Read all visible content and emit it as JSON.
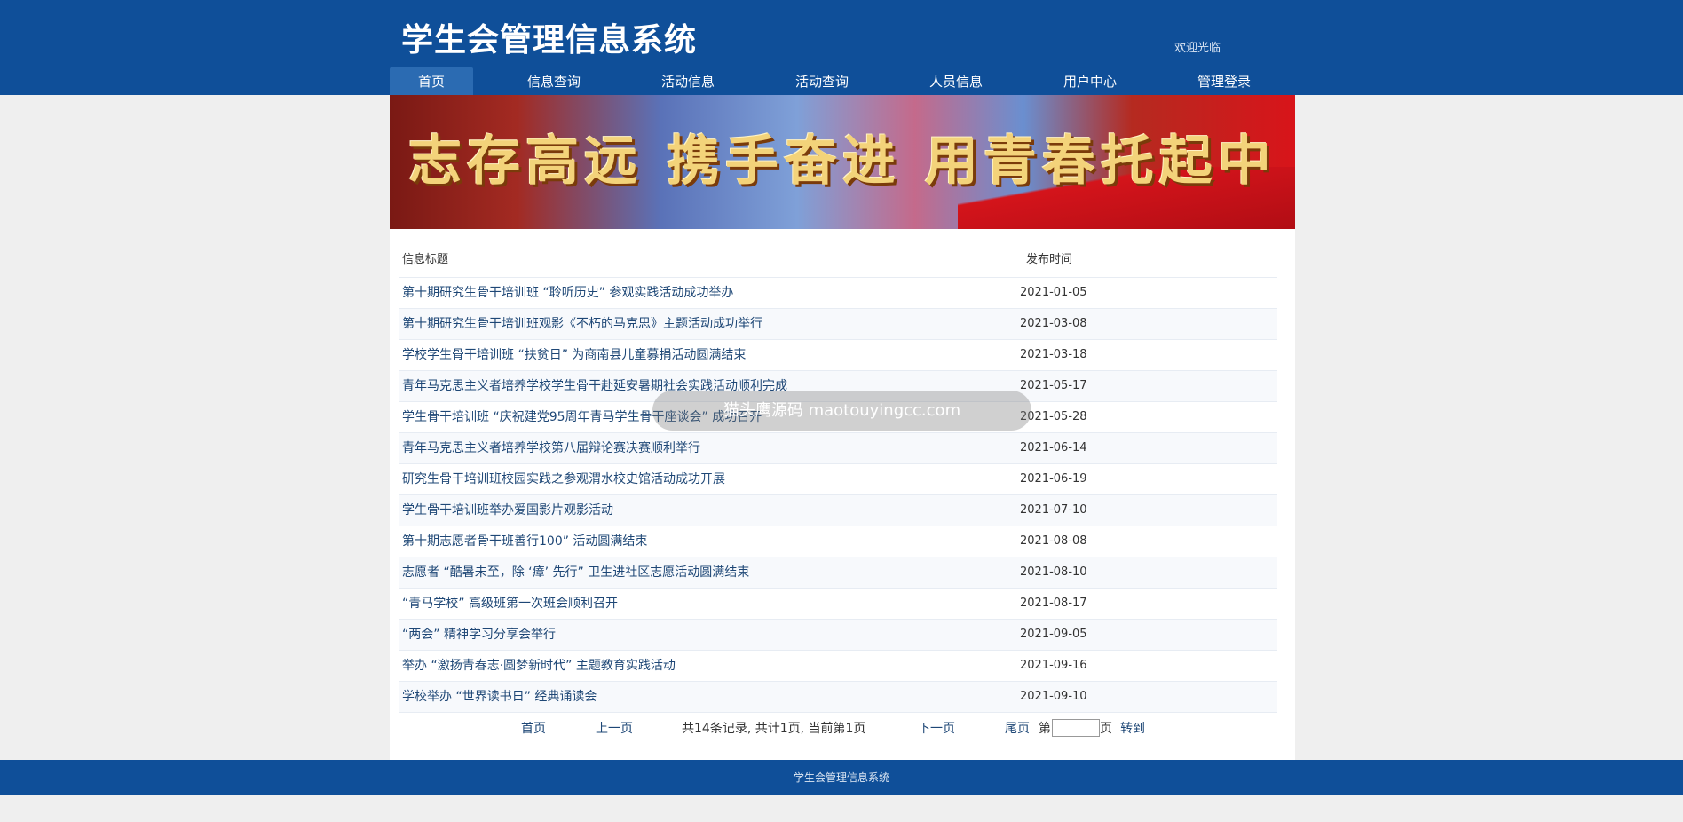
{
  "header": {
    "title": "学生会管理信息系统",
    "welcome": "欢迎光临"
  },
  "nav": {
    "items": [
      "首页",
      "信息查询",
      "活动信息",
      "活动查询",
      "人员信息",
      "用户中心",
      "管理登录"
    ]
  },
  "banner": {
    "slogan": "志存高远 携手奋进 用青春托起中国梦"
  },
  "table": {
    "headers": {
      "title": "信息标题",
      "date": "发布时间"
    },
    "rows": [
      {
        "title": "第十期研究生骨干培训班 “聆听历史” 参观实践活动成功举办",
        "date": "2021-01-05"
      },
      {
        "title": "第十期研究生骨干培训班观影《不朽的马克思》主题活动成功举行",
        "date": "2021-03-08"
      },
      {
        "title": "学校学生骨干培训班 “扶贫日” 为商南县儿童募捐活动圆满结束",
        "date": "2021-03-18"
      },
      {
        "title": "青年马克思主义者培养学校学生骨干赴延安暑期社会实践活动顺利完成",
        "date": "2021-05-17"
      },
      {
        "title": "学生骨干培训班 “庆祝建党95周年青马学生骨干座谈会” 成功召开",
        "date": "2021-05-28"
      },
      {
        "title": "青年马克思主义者培养学校第八届辩论赛决赛顺利举行",
        "date": "2021-06-14"
      },
      {
        "title": "研究生骨干培训班校园实践之参观渭水校史馆活动成功开展",
        "date": "2021-06-19"
      },
      {
        "title": "学生骨干培训班举办爱国影片观影活动",
        "date": "2021-07-10"
      },
      {
        "title": "第十期志愿者骨干班善行100” 活动圆满结束",
        "date": "2021-08-08"
      },
      {
        "title": "志愿者 “酷暑未至，除 ‘瘴’ 先行” 卫生进社区志愿活动圆满结束",
        "date": "2021-08-10"
      },
      {
        "title": " “青马学校” 高级班第一次班会顺利召开",
        "date": "2021-08-17"
      },
      {
        "title": " “两会” 精神学习分享会举行",
        "date": "2021-09-05"
      },
      {
        "title": "举办 “激扬青春志·圆梦新时代” 主题教育实践活动",
        "date": "2021-09-16"
      },
      {
        "title": "学校举办 “世界读书日” 经典诵读会",
        "date": "2021-09-10"
      }
    ]
  },
  "pager": {
    "first": "首页",
    "prev": "上一页",
    "summary": "共14条记录, 共计1页, 当前第1页",
    "next": "下一页",
    "last": "尾页",
    "page_prefix": "第",
    "page_suffix": "页",
    "go": "转到",
    "page_value": ""
  },
  "overlay": {
    "text": "猫头鹰源码 maotouyingcc.com"
  },
  "footer": {
    "text": "学生会管理信息系统"
  }
}
